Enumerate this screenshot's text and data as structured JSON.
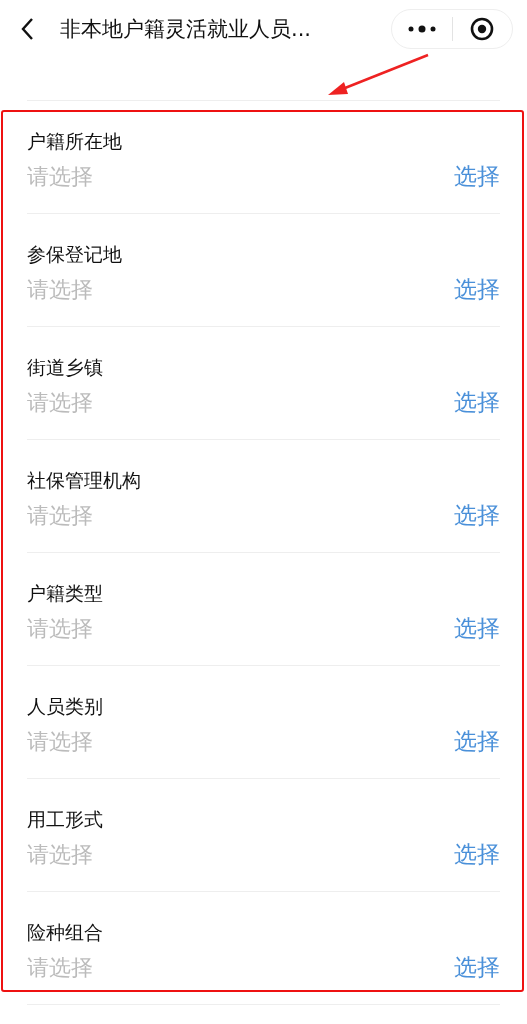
{
  "header": {
    "title": "非本地户籍灵活就业人员..."
  },
  "fields": [
    {
      "label": "户籍所在地",
      "placeholder": "请选择",
      "action": "选择"
    },
    {
      "label": "参保登记地",
      "placeholder": "请选择",
      "action": "选择"
    },
    {
      "label": "街道乡镇",
      "placeholder": "请选择",
      "action": "选择"
    },
    {
      "label": "社保管理机构",
      "placeholder": "请选择",
      "action": "选择"
    },
    {
      "label": "户籍类型",
      "placeholder": "请选择",
      "action": "选择"
    },
    {
      "label": "人员类别",
      "placeholder": "请选择",
      "action": "选择"
    },
    {
      "label": "用工形式",
      "placeholder": "请选择",
      "action": "选择"
    },
    {
      "label": "险种组合",
      "placeholder": "请选择",
      "action": "选择"
    }
  ]
}
